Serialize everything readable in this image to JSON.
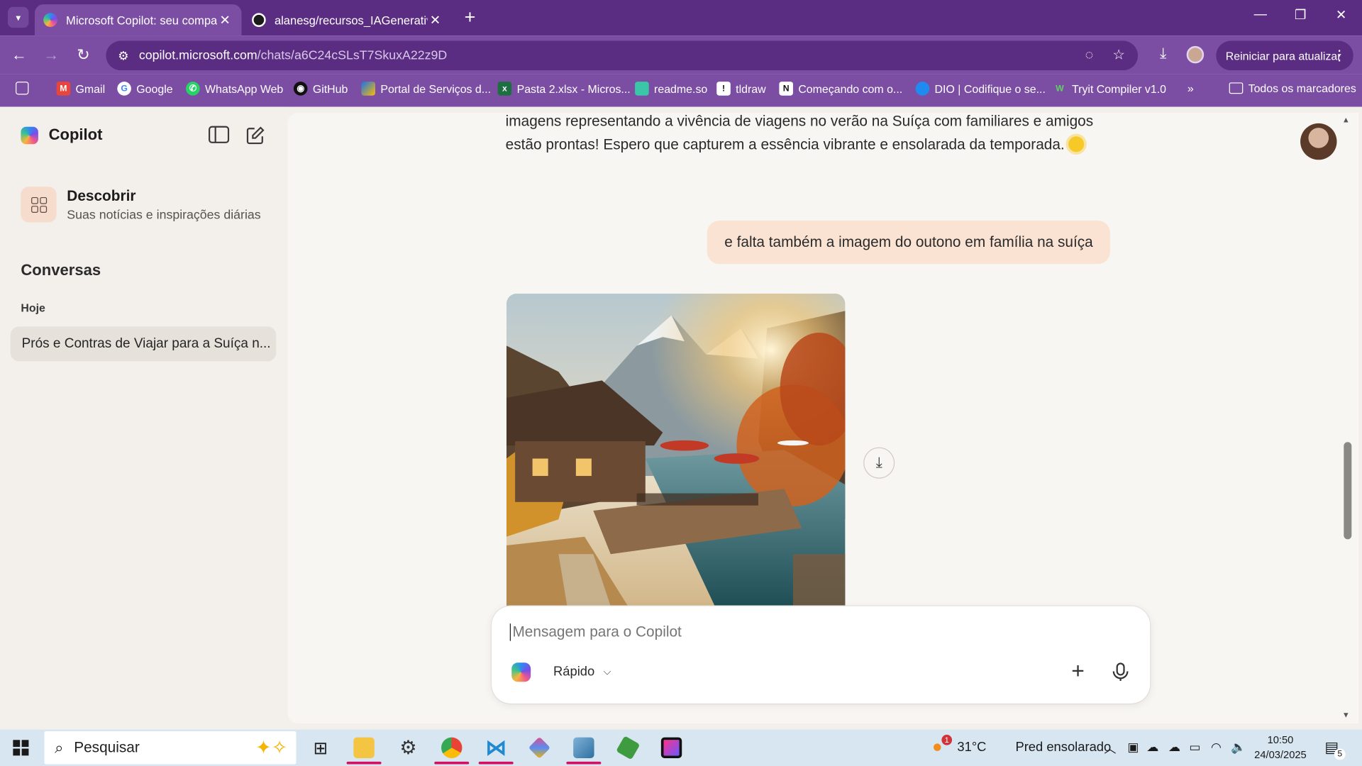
{
  "browser": {
    "tabs": [
      {
        "title": "Microsoft Copilot: seu compan",
        "active": true
      },
      {
        "title": "alanesg/recursos_IAGenerativa_",
        "active": false
      }
    ],
    "url_host": "copilot.microsoft.com",
    "url_path": "/chats/a6C24cSLsT7SkuxA22z9D",
    "update_button": "Reiniciar para atualizar",
    "bookmarks": [
      "Gmail",
      "Google",
      "WhatsApp Web",
      "GitHub",
      "Portal de Serviços d...",
      "Pasta 2.xlsx - Micros...",
      "readme.so",
      "tldraw",
      "Começando com o...",
      "DIO | Codifique o se...",
      "Tryit Compiler v1.0"
    ],
    "all_bookmarks": "Todos os marcadores"
  },
  "sidebar": {
    "brand": "Copilot",
    "discover_title": "Descobrir",
    "discover_subtitle": "Suas notícias e inspirações diárias",
    "conversations_title": "Conversas",
    "today_label": "Hoje",
    "conversation_item": "Prós e Contras de Viajar para a Suíça n..."
  },
  "chat": {
    "assistant_line1": "imagens representando a vivência de viagens no verão na Suíça com familiares e amigos",
    "assistant_line2": "estão prontas! Espero que capturem a essência vibrante e ensolarada da temporada.",
    "user_message": "e falta também a imagem do outono em família na suíça"
  },
  "composer": {
    "placeholder": "Mensagem para o Copilot",
    "mode": "Rápido"
  },
  "taskbar": {
    "search_placeholder": "Pesquisar",
    "weather_temp": "31°C",
    "weather_text": "Pred ensolarado",
    "weather_badge": "1",
    "time": "10:50",
    "date": "24/03/2025",
    "notifications": "5"
  },
  "colors": {
    "browser_frame": "#5b2d82",
    "toolbar": "#7b4ea4",
    "user_bubble": "#fbe3d3",
    "page_background": "#f3efeb"
  }
}
